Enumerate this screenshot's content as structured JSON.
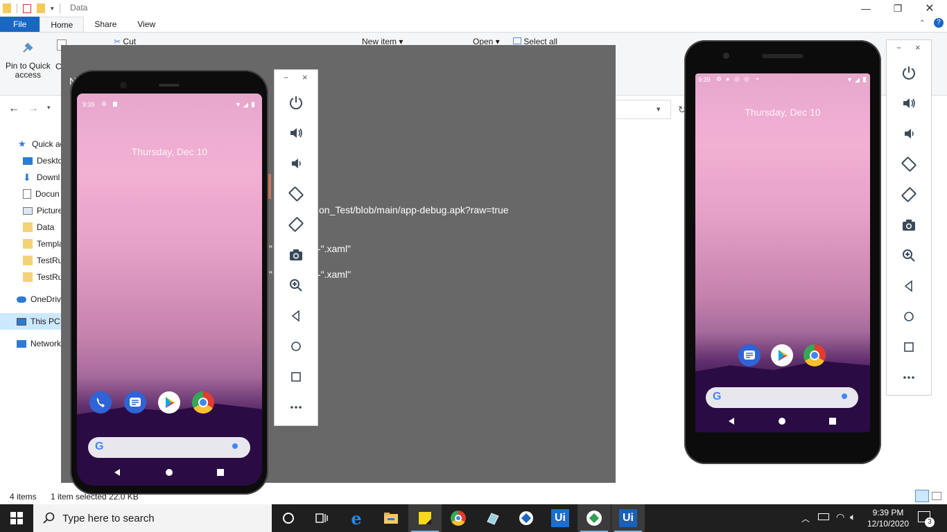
{
  "explorer": {
    "title": "Data",
    "tabs": {
      "file": "File",
      "home": "Home",
      "share": "Share",
      "view": "View"
    },
    "ribbon": {
      "pin_label_1": "Pin to Quick",
      "pin_label_2": "access",
      "copy_partial": "C",
      "cut": "Cut",
      "new_item": "New item",
      "open": "Open",
      "select_all": "Select all"
    },
    "nav": {
      "quick_access": "Quick ac",
      "desktop": "Deskto",
      "downloads": "Downl",
      "documents": "Docun",
      "pictures": "Picture",
      "data": "Data",
      "templates": "Templa",
      "testrun1": "TestRu",
      "testrun2": "TestRu",
      "onedrive": "OneDriv",
      "this_pc": "This PC",
      "network": "Network"
    },
    "status": {
      "items": "4 items",
      "selected": "1 item selected  22.0 KB"
    },
    "partial_title": "N"
  },
  "gray_window": {
    "url_fragment_a": "i",
    "url_fragment_b": "on_Test/blob/main/app-debug.apk?raw=true",
    "xaml_1": "-\".xaml\"",
    "xaml_2": "-\".xaml\"",
    "quote_1": "\"",
    "quote_2": "\""
  },
  "phone_left": {
    "time": "9:39",
    "date": "Thursday, Dec 10",
    "apps": [
      "phone-icon",
      "messages-icon",
      "play-store-icon",
      "chrome-icon"
    ]
  },
  "phone_right": {
    "time": "9:39",
    "date": "Thursday, Dec 10",
    "apps": [
      "messages-icon",
      "play-store-icon",
      "chrome-icon"
    ]
  },
  "emulator_toolbar": {
    "buttons": [
      "power-icon",
      "volume-up-icon",
      "volume-down-icon",
      "rotate-left-icon",
      "rotate-right-icon",
      "camera-icon",
      "zoom-icon",
      "back-icon",
      "home-icon",
      "overview-icon",
      "more-icon"
    ],
    "minimize": "−",
    "close": "×"
  },
  "taskbar": {
    "search_placeholder": "Type here to search",
    "time": "9:39 PM",
    "date": "12/10/2020",
    "notification_count": "3",
    "apps": [
      "cortana-icon",
      "task-view-icon",
      "edge-icon",
      "file-explorer-icon",
      "sticky-notes-icon",
      "chrome-icon",
      "app-icon",
      "app-icon",
      "uipath-icon",
      "app-icon",
      "uipath-icon"
    ],
    "ui_label": "Ui"
  },
  "colors": {
    "file_tab": "#1a67c1",
    "gray_window": "#686868",
    "taskbar": "#1f1f1f",
    "accent": "#76b9ed"
  }
}
